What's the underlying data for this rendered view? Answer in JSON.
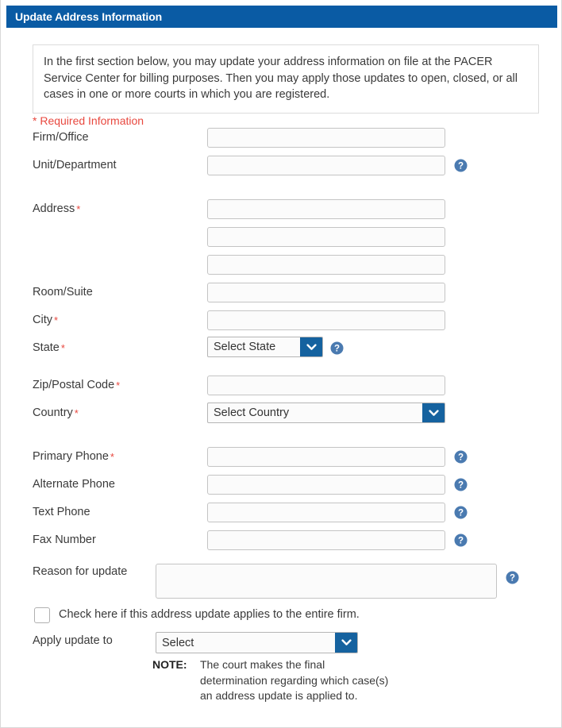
{
  "header": {
    "title": "Update Address Information"
  },
  "info": {
    "text": "In the first section below, you may update your address information on file at the PACER Service Center for billing purposes. Then you may apply those updates to open, closed, or all cases in one or more courts in which you are registered."
  },
  "required_note": "* Required Information",
  "icons": {
    "help": "help-icon",
    "chevron_down": "chevron-down-icon"
  },
  "colors": {
    "header_blue": "#0a5ba4",
    "accent_blue": "#15629f",
    "required_red": "#e8483f",
    "help_blue": "#4a7ab0",
    "field_border": "#c4c4c4"
  },
  "fields": [
    {
      "label": "Firm/Office",
      "required": false,
      "value": "",
      "help": false
    },
    {
      "label": "Unit/Department",
      "required": false,
      "value": "",
      "help": true
    },
    {
      "label": "Address",
      "required": true,
      "value": "",
      "help": false
    },
    {
      "label": "",
      "required": false,
      "value": "",
      "help": false
    },
    {
      "label": "",
      "required": false,
      "value": "",
      "help": false
    },
    {
      "label": "Room/Suite",
      "required": false,
      "value": "",
      "help": false
    },
    {
      "label": "City",
      "required": true,
      "value": "",
      "help": false
    }
  ],
  "state_row": {
    "label": "State",
    "required": true,
    "selected": "Select State",
    "help": true
  },
  "zip_row": {
    "label": "Zip/Postal Code",
    "required": true,
    "value": "",
    "help": false
  },
  "country_row": {
    "label": "Country",
    "required": true,
    "selected": "Select Country",
    "help": false
  },
  "phone_fields": [
    {
      "label": "Primary Phone",
      "required": true,
      "value": "",
      "help": true
    },
    {
      "label": "Alternate Phone",
      "required": false,
      "value": "",
      "help": true
    },
    {
      "label": "Text Phone",
      "required": false,
      "value": "",
      "help": true
    },
    {
      "label": "Fax Number",
      "required": false,
      "value": "",
      "help": true
    }
  ],
  "reason": {
    "label": "Reason for update",
    "value": "",
    "help": true
  },
  "firm_checkbox": {
    "checked": false,
    "label": "Check here if this address update applies to the entire firm."
  },
  "apply_update": {
    "label": "Apply update to",
    "selected": "Select"
  },
  "note": {
    "label": "NOTE:",
    "text": "The court makes the final determination regarding which case(s) an address update is applied to."
  }
}
